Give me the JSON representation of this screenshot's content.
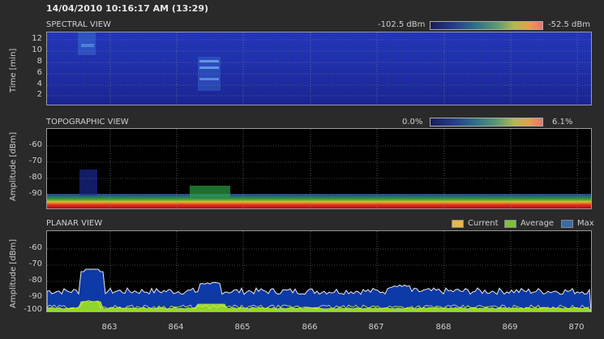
{
  "timestamp": "14/04/2010 10:16:17 AM (13:29)",
  "spectral": {
    "title": "SPECTRAL VIEW",
    "min_label": "-102.5 dBm",
    "max_label": "-52.5 dBm",
    "ylabel": "Time [min]",
    "yticks": [
      "12",
      "10",
      "8",
      "6",
      "4",
      "2"
    ]
  },
  "topographic": {
    "title": "TOPOGRAPHIC VIEW",
    "min_label": "0.0%",
    "max_label": "6.1%",
    "ylabel": "Amplitude [dBm]",
    "yticks": [
      "-60",
      "-70",
      "-80",
      "-90"
    ]
  },
  "planar": {
    "title": "PLANAR VIEW",
    "ylabel": "Amplitude [dBm]",
    "yticks": [
      "-60",
      "-70",
      "-80",
      "-90",
      "-100"
    ],
    "legend": [
      {
        "label": "Current",
        "color": "#e8b84a"
      },
      {
        "label": "Average",
        "color": "#7fbf3f"
      },
      {
        "label": "Max",
        "color": "#3a6aa8"
      }
    ]
  },
  "xaxis": {
    "ticks": [
      "863",
      "864",
      "865",
      "866",
      "867",
      "868",
      "869",
      "870"
    ]
  },
  "colors": {
    "background": "#2a2a2a",
    "spectral_base": "#1f2c9c",
    "max_fill": "#0d3aa6",
    "average_fill": "#8fd62a",
    "current_line": "#f0e040"
  }
}
